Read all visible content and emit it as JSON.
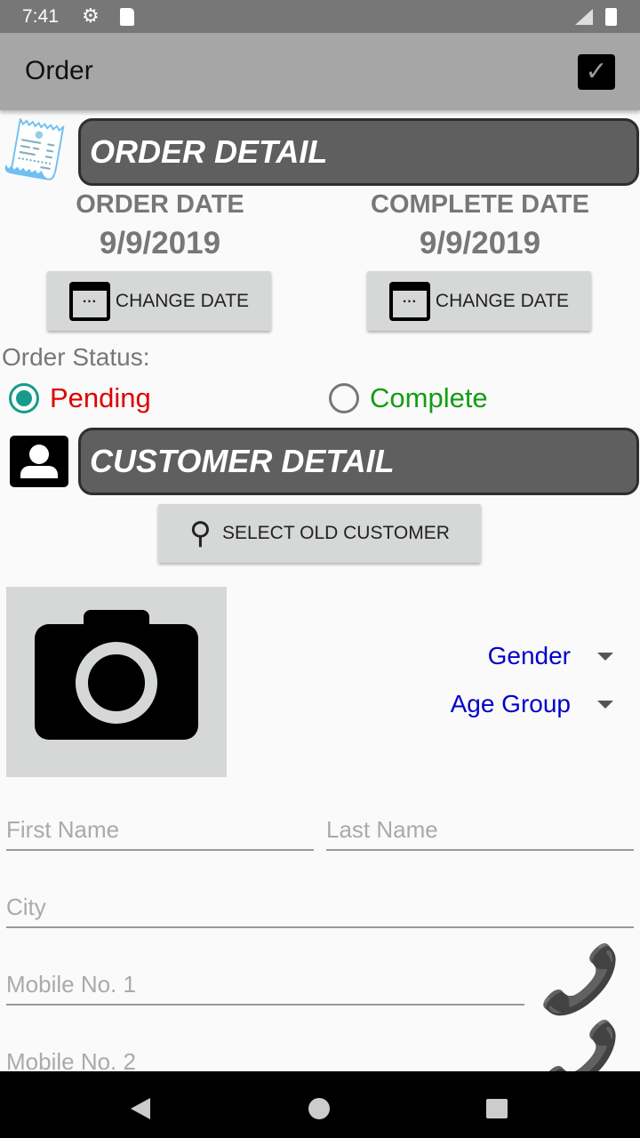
{
  "status_bar": {
    "time": "7:41"
  },
  "app_bar": {
    "title": "Order"
  },
  "order_detail": {
    "header": "ORDER DETAIL",
    "order_date_label": "ORDER DATE",
    "order_date": "9/9/2019",
    "complete_date_label": "COMPLETE DATE",
    "complete_date": "9/9/2019",
    "change_date": "CHANGE DATE"
  },
  "order_status": {
    "label": "Order Status:",
    "options": [
      {
        "label": "Pending",
        "selected": true,
        "color": "#e00000"
      },
      {
        "label": "Complete",
        "selected": false,
        "color": "#139d13"
      }
    ]
  },
  "customer_detail": {
    "header": "CUSTOMER DETAIL",
    "select_old": "SELECT OLD CUSTOMER",
    "gender": "Gender",
    "age_group": "Age Group"
  },
  "form": {
    "first_name": "First Name",
    "last_name": "Last Name",
    "city": "City",
    "mobile1": "Mobile No. 1",
    "mobile2": "Mobile No. 2"
  }
}
